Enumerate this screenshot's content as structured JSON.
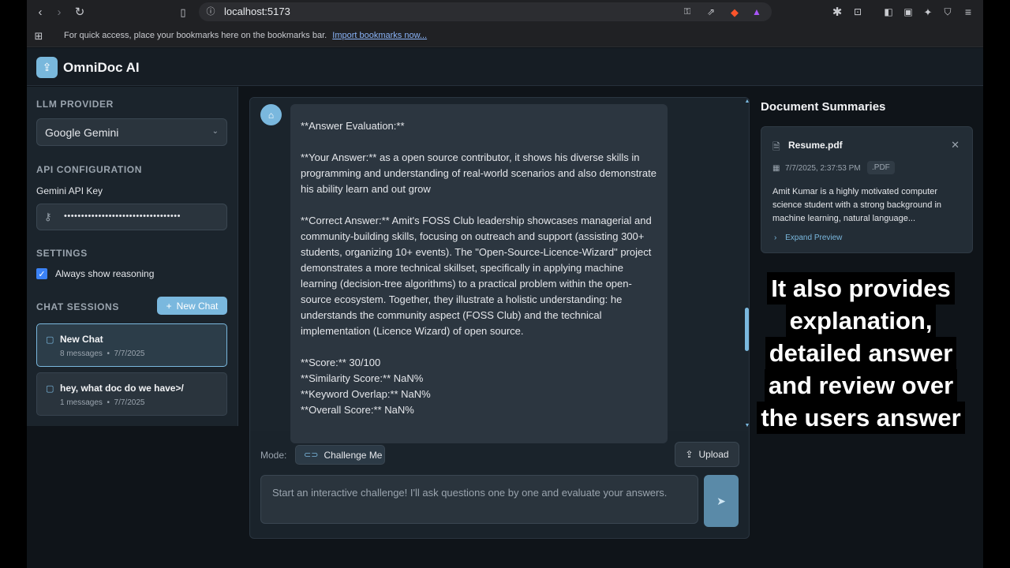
{
  "browser": {
    "url": "localhost:5173",
    "bookmarks_text": "For quick access, place your bookmarks here on the bookmarks bar.",
    "bookmarks_link": "Import bookmarks now..."
  },
  "app": {
    "title": "OmniDoc AI"
  },
  "sidebar": {
    "llm_provider_label": "LLM PROVIDER",
    "provider_value": "Google Gemini",
    "api_config_label": "API CONFIGURATION",
    "api_key_label": "Gemini API Key",
    "api_key_masked": "••••••••••••••••••••••••••••••••••",
    "settings_label": "SETTINGS",
    "always_reasoning_label": "Always show reasoning",
    "chat_sessions_label": "CHAT SESSIONS",
    "new_chat_button": "New Chat",
    "sessions": [
      {
        "title": "New Chat",
        "meta": "8 messages  •  7/7/2025"
      },
      {
        "title": "hey, what doc do we have>/",
        "meta": "1 messages  •  7/7/2025"
      }
    ]
  },
  "chat": {
    "message_lines": {
      "l1": "**Answer Evaluation:**",
      "p2": "**Your Answer:** as a open source contributor, it shows his diverse skills in programming and understanding of real-world scenarios and also demonstrate his ability learn and out grow",
      "p3": "**Correct Answer:** Amit's FOSS Club leadership showcases managerial and community-building skills, focusing on outreach and support (assisting 300+ students, organizing 10+ events).  The \"Open-Source-Licence-Wizard\" project demonstrates a more technical skillset, specifically in applying machine learning (decision-tree algorithms) to a practical problem within the open-source ecosystem.  Together, they illustrate a holistic understanding: he understands the community aspect (FOSS Club) and the technical implementation (Licence Wizard) of open source.",
      "s1": "**Score:** 30/100",
      "s2": "**Similarity Score:** NaN%",
      "s3": "**Keyword Overlap:** NaN%",
      "s4": "**Overall Score:** NaN%"
    },
    "mode_label": "Mode:",
    "mode_value": "Challenge Me",
    "upload_button": "Upload",
    "input_placeholder": "Start an interactive challenge! I'll ask questions one by one and evaluate your answers."
  },
  "documents": {
    "title": "Document Summaries",
    "items": [
      {
        "name": "Resume.pdf",
        "date": "7/7/2025, 2:37:53 PM",
        "badge": ".PDF",
        "summary": "Amit Kumar is a highly motivated computer science student with a strong background in machine learning, natural language...",
        "expand": "Expand Preview"
      }
    ]
  },
  "caption": {
    "lines": [
      "It also provides",
      "explanation,",
      "detailed answer",
      "and review over",
      "the users answer"
    ]
  },
  "colors": {
    "accent": "#7ab8de",
    "background": "#0f1419",
    "panel": "#1b242c"
  }
}
